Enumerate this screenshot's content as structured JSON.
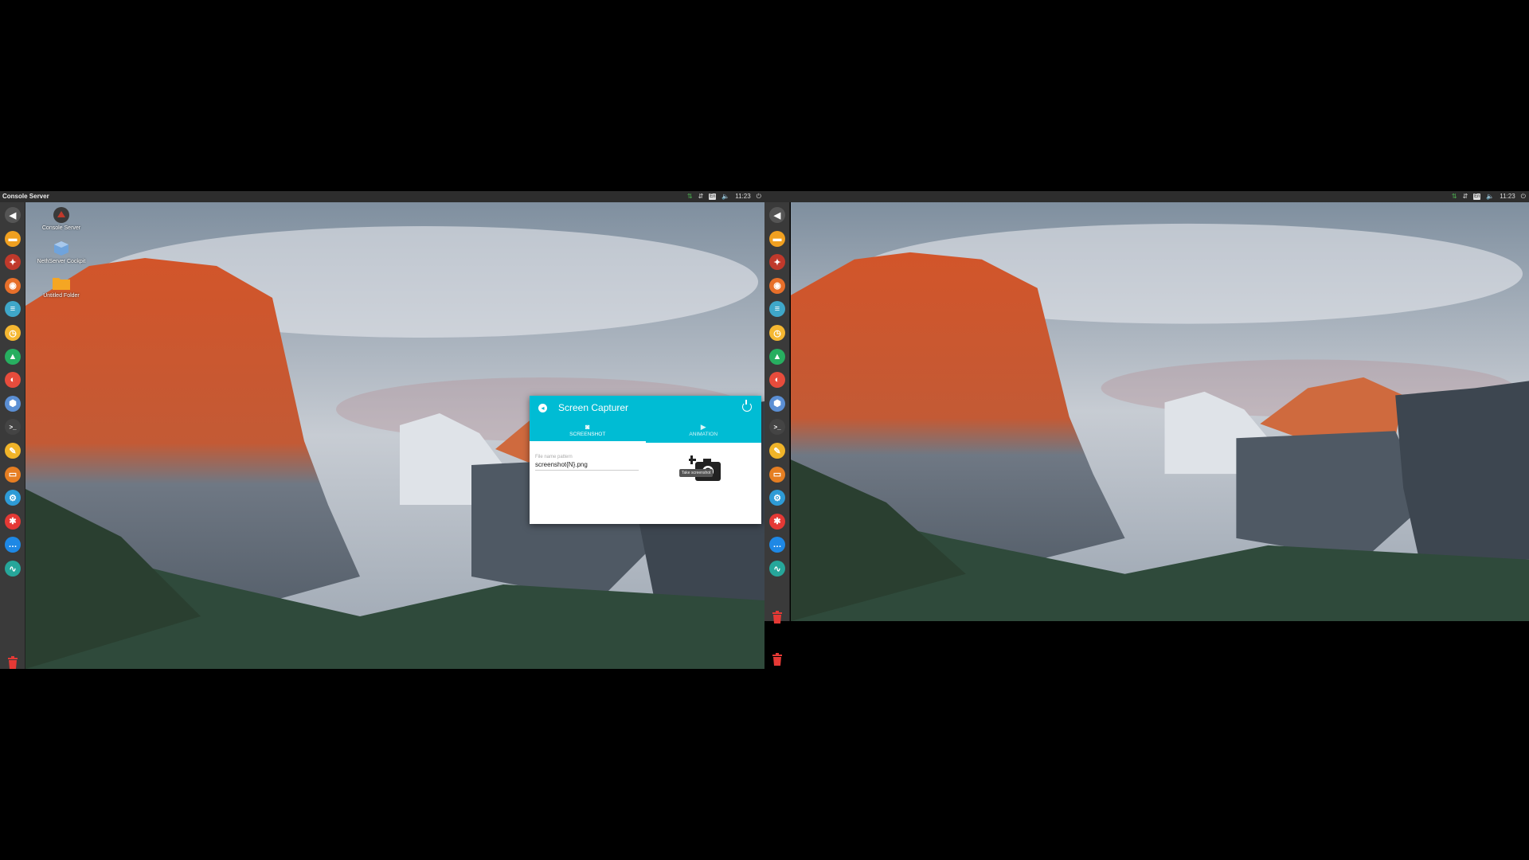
{
  "left_screen": {
    "topbar": {
      "title": "Console Server",
      "clock": "11:23",
      "keyboard": "En"
    },
    "desktop_icons": [
      {
        "label": "Console Server",
        "icon": "console-server-icon"
      },
      {
        "label": "NethServer Cockpit",
        "icon": "cube-icon"
      },
      {
        "label": "Untitled Folder",
        "icon": "folder-icon"
      }
    ],
    "capturer": {
      "title": "Screen Capturer",
      "tabs": [
        {
          "label": "SCREENSHOT",
          "icon": "camera-icon"
        },
        {
          "label": "ANIMATION",
          "icon": "video-icon"
        }
      ],
      "field_label": "File name pattern",
      "field_value": "screenshot{N}.png",
      "tooltip": "Take screenshot",
      "accent": "#00bcd4"
    }
  },
  "right_screen": {
    "topbar": {
      "title": "",
      "clock": "11:23",
      "keyboard": "En"
    }
  },
  "dock_icons": [
    {
      "name": "back-icon",
      "color": "#555555",
      "glyph": "◀"
    },
    {
      "name": "folder-icon",
      "color": "#f0a020",
      "glyph": "▬"
    },
    {
      "name": "console-server-icon",
      "color": "#c0392b",
      "glyph": "✦"
    },
    {
      "name": "browser-icon",
      "color": "#e76f2a",
      "glyph": "◉"
    },
    {
      "name": "document-icon",
      "color": "#3fa7c9",
      "glyph": "≡"
    },
    {
      "name": "clock-icon",
      "color": "#f5b731",
      "glyph": "◷"
    },
    {
      "name": "chart-icon",
      "color": "#27ae60",
      "glyph": "▲"
    },
    {
      "name": "pie-icon",
      "color": "#e74c3c",
      "glyph": "◐"
    },
    {
      "name": "cube-icon",
      "color": "#5b8fd4",
      "glyph": "⬢"
    },
    {
      "name": "terminal-icon",
      "color": "#444444",
      "glyph": ">_"
    },
    {
      "name": "pen-icon",
      "color": "#f0b429",
      "glyph": "✎"
    },
    {
      "name": "slides-icon",
      "color": "#e67e22",
      "glyph": "▭"
    },
    {
      "name": "settings-icon",
      "color": "#2e9bd6",
      "glyph": "⚙"
    },
    {
      "name": "bug-icon",
      "color": "#e53935",
      "glyph": "✱"
    },
    {
      "name": "more-icon",
      "color": "#1e88e5",
      "glyph": "…"
    },
    {
      "name": "activity-icon",
      "color": "#26a69a",
      "glyph": "∿"
    }
  ]
}
